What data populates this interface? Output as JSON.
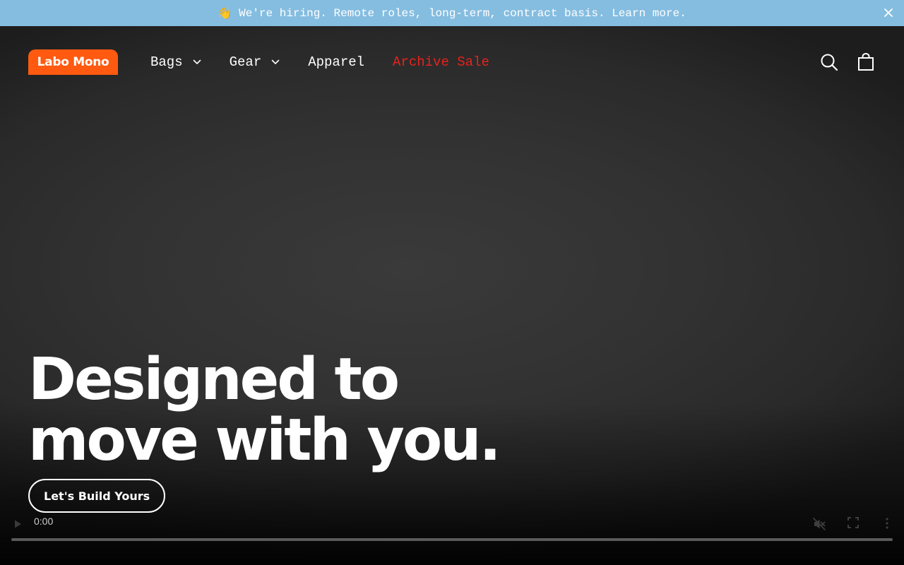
{
  "announcement": {
    "emoji": "👋",
    "text": "We're hiring. Remote roles, long-term, contract basis. Learn more."
  },
  "header": {
    "logo_text": "Labo Mono",
    "nav": [
      {
        "label": "Bags",
        "has_dropdown": true
      },
      {
        "label": "Gear",
        "has_dropdown": true
      },
      {
        "label": "Apparel",
        "has_dropdown": false
      },
      {
        "label": "Archive Sale",
        "has_dropdown": false
      }
    ]
  },
  "hero": {
    "headline_line1": "Designed to",
    "headline_line2": "move with you.",
    "cta_label": "Let's Build Yours"
  },
  "video": {
    "time": "0:00",
    "icons": [
      "play-icon",
      "muted-icon",
      "fullscreen-icon",
      "more-options-icon"
    ]
  },
  "colors": {
    "announcement_bg": "#85bde0",
    "logo_bg": "#ff5a10",
    "sale_red": "#e8221c"
  }
}
